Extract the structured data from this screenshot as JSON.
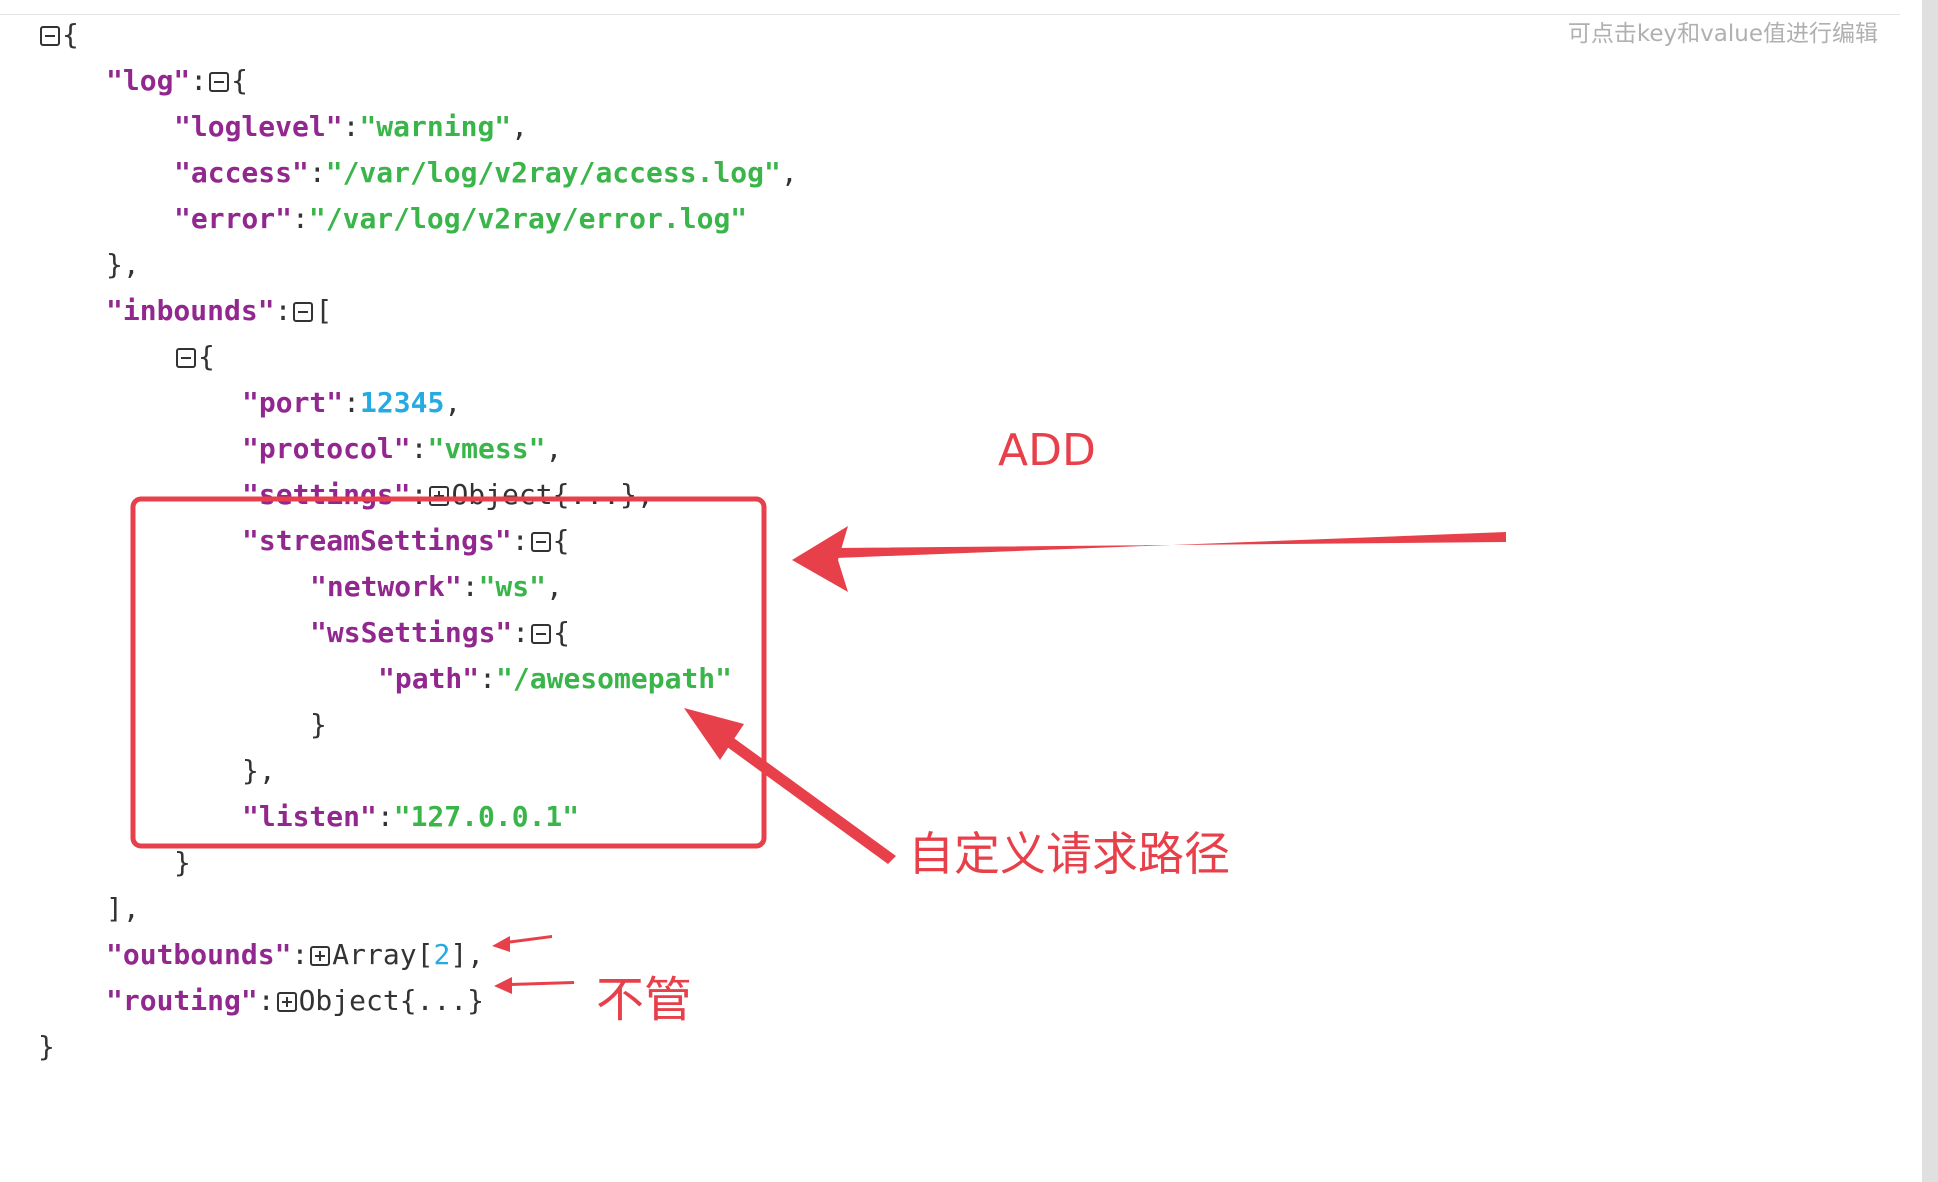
{
  "hint": "可点击key和value值进行编辑",
  "json": {
    "log_key": "\"log\"",
    "loglevel_key": "\"loglevel\"",
    "loglevel_val": "\"warning\"",
    "access_key": "\"access\"",
    "access_val": "\"/var/log/v2ray/access.log\"",
    "error_key": "\"error\"",
    "error_val": "\"/var/log/v2ray/error.log\"",
    "inbounds_key": "\"inbounds\"",
    "port_key": "\"port\"",
    "port_val": "12345",
    "protocol_key": "\"protocol\"",
    "protocol_val": "\"vmess\"",
    "settings_key": "\"settings\"",
    "settings_collapsed": "Object{...}",
    "streamSettings_key": "\"streamSettings\"",
    "network_key": "\"network\"",
    "network_val": "\"ws\"",
    "wsSettings_key": "\"wsSettings\"",
    "path_key": "\"path\"",
    "path_val": "\"/awesomepath\"",
    "listen_key": "\"listen\"",
    "listen_val": "\"127.0.0.1\"",
    "outbounds_key": "\"outbounds\"",
    "outbounds_collapsed_prefix": "Array[",
    "outbounds_count": "2",
    "outbounds_collapsed_suffix": "]",
    "routing_key": "\"routing\"",
    "routing_collapsed": "Object{...}"
  },
  "annotations": {
    "add_label": "ADD",
    "path_label": "自定义请求路径",
    "ignore_label": "不管",
    "color": "#e8404a"
  },
  "colors": {
    "key": "#92278f",
    "string": "#3ab54a",
    "number": "#25aae1"
  }
}
